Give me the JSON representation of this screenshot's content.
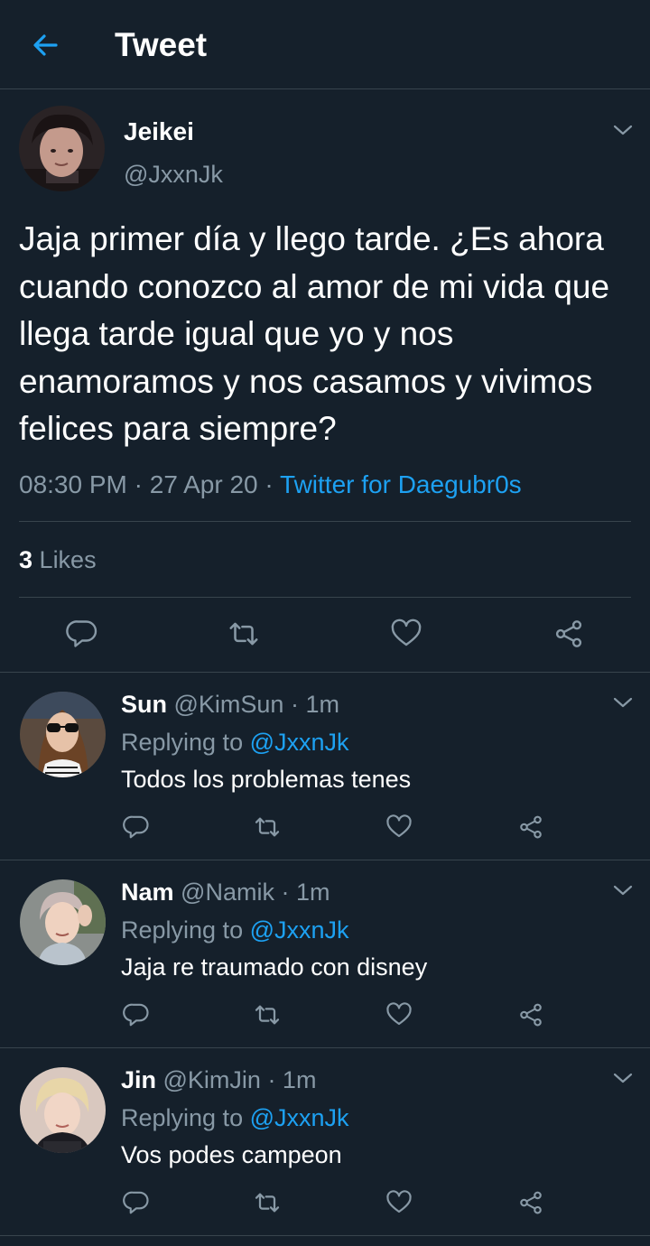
{
  "header": {
    "title": "Tweet",
    "back_icon": "arrow-left-icon",
    "accent_color": "#1da1f2"
  },
  "tweet": {
    "name": "Jeikei",
    "handle": "@JxxnJk",
    "text": "Jaja primer día y llego tarde. ¿Es ahora cuando conozco al amor de mi vida que llega tarde igual que yo y nos enamoramos y nos casamos y vivimos felices para siempre?",
    "time": "08:30 PM",
    "date": "27 Apr 20",
    "separator": " · ",
    "source": "Twitter for Daegubr0s",
    "likes_count": "3",
    "likes_label": "Likes",
    "actions": [
      "reply-icon",
      "retweet-icon",
      "like-icon",
      "share-icon"
    ]
  },
  "replies": [
    {
      "name": "Sun",
      "handle_time": " @KimSun · 1m",
      "replying_label": "Replying to ",
      "mention": "@JxxnJk",
      "text": "Todos los problemas tenes"
    },
    {
      "name": "Nam",
      "handle_time": " @Namik · 1m",
      "replying_label": "Replying to ",
      "mention": "@JxxnJk",
      "text": "Jaja re traumado con disney"
    },
    {
      "name": "Jin",
      "handle_time": " @KimJin · 1m",
      "replying_label": "Replying to ",
      "mention": "@JxxnJk",
      "text": "Vos podes campeon"
    }
  ],
  "colors": {
    "background": "#15202b",
    "border": "#38444d",
    "secondary_text": "#8899a6",
    "icon": "#8899a6"
  }
}
